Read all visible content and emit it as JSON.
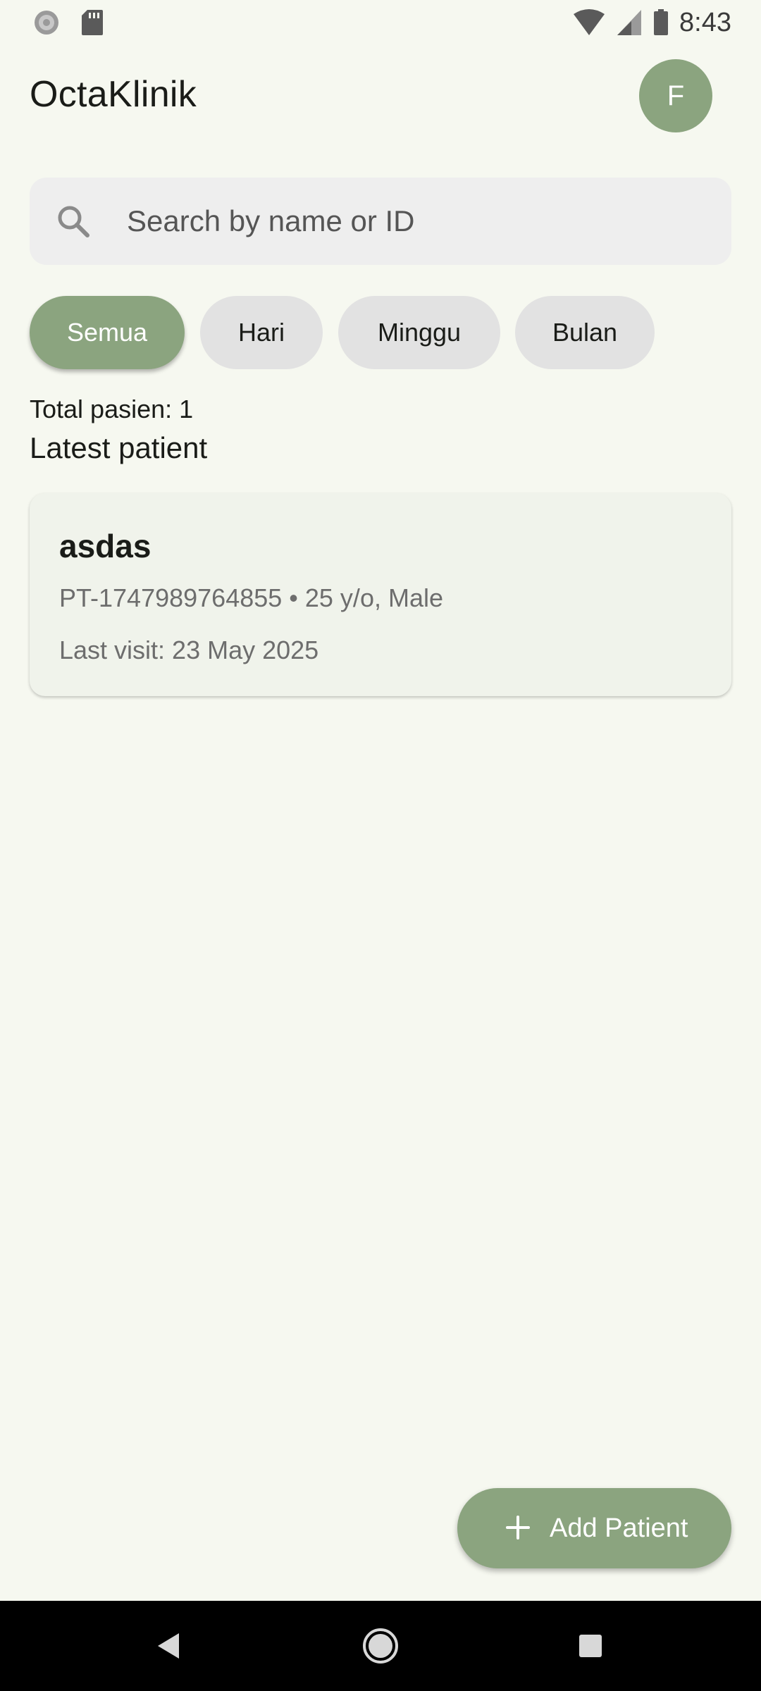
{
  "status_bar": {
    "time": "8:43",
    "left_icons": [
      "spinner-icon",
      "sd-card-icon"
    ],
    "right_icons": [
      "wifi-icon",
      "cellular-signal-icon",
      "battery-icon"
    ]
  },
  "header": {
    "title": "OctaKlinik",
    "avatar_initial": "F"
  },
  "search": {
    "placeholder": "Search by name or ID",
    "value": "",
    "icon": "search-icon"
  },
  "filters": {
    "chips": [
      {
        "label": "Semua",
        "selected": true
      },
      {
        "label": "Hari",
        "selected": false
      },
      {
        "label": "Minggu",
        "selected": false
      },
      {
        "label": "Bulan",
        "selected": false
      }
    ]
  },
  "summary": {
    "total_label": "Total pasien: 1",
    "section_title": "Latest patient"
  },
  "patients": [
    {
      "name": "asdas",
      "meta": "PT-1747989764855 • 25 y/o, Male",
      "last_visit": "Last visit: 23 May 2025"
    }
  ],
  "fab": {
    "label": "Add Patient",
    "icon": "plus-icon"
  },
  "nav_bar": {
    "buttons": [
      "back-icon",
      "home-icon",
      "recents-icon"
    ]
  },
  "colors": {
    "accent": "#8ba47f",
    "background": "#f6f8f0",
    "card": "#f0f3eb",
    "chip": "#e2e2e2",
    "search_bg": "#eeeeee"
  }
}
